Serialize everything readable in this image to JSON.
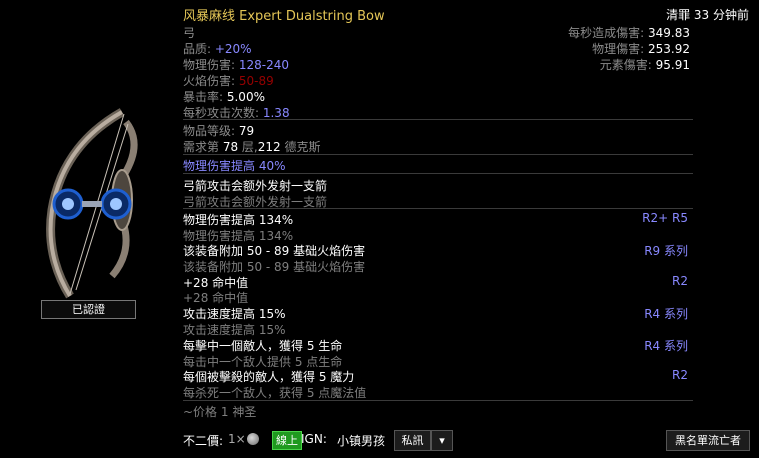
{
  "item": {
    "title": "风暴麻线 Expert Dualstring Bow",
    "type": "弓",
    "quality_label": "品质: ",
    "quality_value": "+20%",
    "phys_label": "物理伤害: ",
    "phys_value": "128-240",
    "fire_label": "火焰伤害: ",
    "fire_value": "50-89",
    "crit_label": "暴击率: ",
    "crit_value": "5.00%",
    "aps_label": "每秒攻击次数: ",
    "aps_value": "1.38",
    "level_label": "物品等级: ",
    "level_value": "79",
    "req_prefix": "需求第 ",
    "req_floor": "78",
    "req_mid": " 层,",
    "req_num": "212",
    "req_suffix": " 德克斯",
    "implicit": "物理伤害提高 40%"
  },
  "corner_text": "清罪 33 分钟前",
  "dps": {
    "total_label": "每秒造成傷害: ",
    "total_value": "349.83",
    "phys_label": "物理傷害: ",
    "phys_value": "253.92",
    "ele_label": "元素傷害: ",
    "ele_value": "95.91"
  },
  "mods": [
    {
      "text": "弓箭攻击会额外发射一支箭",
      "sub": "弓箭攻击会额外发射一支箭",
      "tier": ""
    },
    {
      "text": "物理伤害提高 134%",
      "sub": "物理伤害提高 134%",
      "tier": "R2+ R5"
    },
    {
      "text": "该装备附加 50 - 89 基础火焰伤害",
      "sub": "该装备附加 50 - 89 基础火焰伤害",
      "tier": "R9 系列"
    },
    {
      "text": "+28 命中值",
      "sub": "+28 命中值",
      "tier": "R2"
    },
    {
      "text": "攻击速度提高 15%",
      "sub": "攻击速度提高 15%",
      "tier": "R4 系列"
    },
    {
      "text": "每擊中一個敵人，獲得 5 生命",
      "sub": "每击中一个敌人提供 5 点生命",
      "tier": "R4 系列"
    },
    {
      "text": "每個被擊殺的敵人，獲得 5 魔力",
      "sub": "每杀死一个敌人，获得 5 点魔法值",
      "tier": "R2"
    }
  ],
  "price_note": "~价格 1 神圣",
  "verified": "已認證",
  "footer": {
    "price_label": "不二價:",
    "qty": "1×",
    "online": "線上",
    "ign_label": "IGN:",
    "ign_name": "小镇男孩",
    "msg_button": "私訊",
    "caret": "▾",
    "blacklist_button": "黑名單流亡者"
  }
}
